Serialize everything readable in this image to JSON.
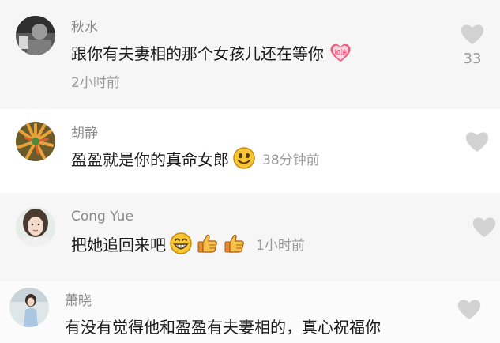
{
  "comments": [
    {
      "username": "秋水",
      "text": "跟你有夫妻相的那个女孩儿还在等你",
      "badge_icon": "heart-badge-icon",
      "badge_label": "加油",
      "time": "2小时前",
      "likes": "33"
    },
    {
      "username": "胡静",
      "text": "盈盈就是你的真命女郎",
      "emoji_icon": "smile-emoji-icon",
      "time": "38分钟前"
    },
    {
      "username": "Cong Yue",
      "text": "把她追回来吧",
      "emoji_icons": [
        "grin-emoji-icon",
        "thumbs-up-emoji-icon",
        "thumbs-up-emoji-icon"
      ],
      "time": "1小时前"
    },
    {
      "username": "萧晓",
      "text": "有没有觉得他和盈盈有夫妻相的，真心祝福你"
    }
  ],
  "colors": {
    "username": "#8a8a8a",
    "body_text": "#1a1a1a",
    "meta": "#9a9a9a",
    "heart_outline": "#c8c8c8",
    "band_gray": "#f6f6f6"
  }
}
